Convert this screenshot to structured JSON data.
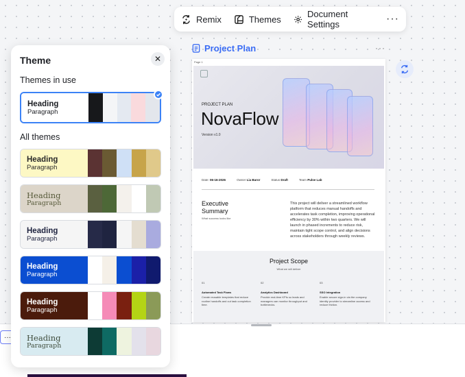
{
  "toolbar": {
    "remix_label": "Remix",
    "themes_label": "Themes",
    "settings_label": "Document Settings",
    "more_label": "···"
  },
  "document": {
    "title": "Project Plan",
    "more_label": "···",
    "page_label": "Page 1",
    "hero": {
      "kicker": "PROJECT PLAN",
      "title": "NovaFlow",
      "version": "Version v1.0"
    },
    "meta": {
      "date_label": "Date",
      "date": "06-16-2026",
      "owner_label": "Owner",
      "owner": "Lia Baror",
      "status_label": "Status",
      "status": "Draft",
      "team_label": "Team",
      "team": "Pulse Lab"
    },
    "summary": {
      "title_line1": "Executive",
      "title_line2": "Summary",
      "subtitle": "What success looks like",
      "body": "This project will deliver a streamlined workflow platform that reduces manual handoffs and accelerates task completion, improving operational efficiency by 30% within two quarters. We will launch in phased increments to reduce risk, maintain tight scope control, and align decisions across stakeholders through weekly reviews."
    },
    "scope": {
      "title": "Project Scope",
      "subtitle": "What we will deliver",
      "items": [
        {
          "num": "01",
          "heading": "Automated Task Flows",
          "desc": "Create reusable templates that reduce routine handoffs and cut task completion time."
        },
        {
          "num": "02",
          "heading": "Analytics Dashboard",
          "desc": "Provide real-time KPIs so leads and managers can monitor throughput and bottlenecks."
        },
        {
          "num": "03",
          "heading": "SSO Integration",
          "desc": "Enable secure sign-in via the company identity provider to streamline access and reduce friction."
        }
      ]
    }
  },
  "panel": {
    "title": "Theme",
    "close_label": "✕",
    "in_use_label": "Themes in use",
    "all_label": "All themes",
    "in_use": {
      "heading": "Heading",
      "paragraph": "Paragraph",
      "bg": "#ffffff",
      "heading_color": "#1d1f24",
      "para_color": "#1d1f24",
      "swatches": [
        "#17181b",
        "#f4f5f7",
        "#e4e9f1",
        "#fadadd",
        "#e3e6ec"
      ]
    },
    "themes": [
      {
        "heading": "Heading",
        "paragraph": "Paragraph",
        "bg": "#fdf8c4",
        "heading_color": "#2a2a2a",
        "para_color": "#2a2a2a",
        "serif": false,
        "swatches": [
          "#5b3333",
          "#6a5a33",
          "#cfe0f6",
          "#c7a44a",
          "#e0c98a"
        ]
      },
      {
        "heading": "Heading",
        "paragraph": "Paragraph",
        "bg": "#dcd5c9",
        "heading_color": "#575a3a",
        "para_color": "#575a3a",
        "serif": true,
        "swatches": [
          "#5a6040",
          "#4d6837",
          "#f4f1ec",
          "#ffffff",
          "#c0c9b4"
        ]
      },
      {
        "heading": "Heading",
        "paragraph": "Paragraph",
        "bg": "#f5f5f5",
        "heading_color": "#1f2440",
        "para_color": "#1f2440",
        "serif": false,
        "swatches": [
          "#262a48",
          "#1f2440",
          "#f5f5f5",
          "#e4ddd0",
          "#a9abdf"
        ]
      },
      {
        "heading": "Heading",
        "paragraph": "Paragraph",
        "bg": "#0b4ed1",
        "heading_color": "#ffffff",
        "para_color": "#ffffff",
        "serif": false,
        "swatches": [
          "#ffffff",
          "#f5f0e8",
          "#0b4ed1",
          "#1b20a8",
          "#101a6e"
        ]
      },
      {
        "heading": "Heading",
        "paragraph": "Paragraph",
        "bg": "#4b1b0c",
        "heading_color": "#ffffff",
        "para_color": "#ffffff",
        "serif": false,
        "swatches": [
          "#ffffff",
          "#f58bb7",
          "#7a2010",
          "#b4d415",
          "#8b9a58"
        ]
      },
      {
        "heading": "Heading",
        "paragraph": "Paragraph",
        "bg": "#d8ebf1",
        "heading_color": "#3d4a3a",
        "para_color": "#3d4a3a",
        "serif": true,
        "swatches": [
          "#0d3b35",
          "#0e6a63",
          "#eef3df",
          "#e3e1eb",
          "#e8d7df"
        ]
      }
    ]
  }
}
